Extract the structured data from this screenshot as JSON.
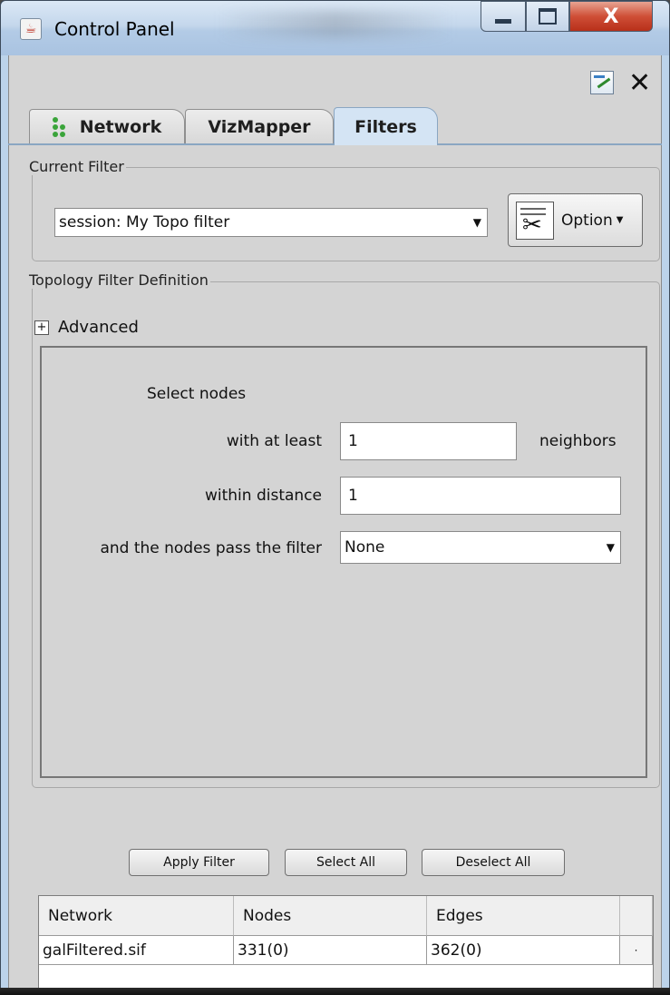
{
  "window": {
    "title": "Control Panel"
  },
  "tabs": [
    {
      "label": "Network"
    },
    {
      "label": "VizMapper"
    },
    {
      "label": "Filters"
    }
  ],
  "current_filter": {
    "legend": "Current Filter",
    "selected": "session: My Topo filter",
    "option_label": "Option"
  },
  "topology": {
    "legend": "Topology Filter Definition",
    "advanced_label": "Advanced",
    "advanced_toggle": "+",
    "select_nodes": "Select nodes",
    "at_least_label": "with at least",
    "at_least_value": "1",
    "neighbors_label": "neighbors",
    "distance_label": "within distance",
    "distance_value": "1",
    "pass_label": "and the nodes pass the filter",
    "pass_value": "None"
  },
  "buttons": {
    "apply": "Apply Filter",
    "select_all": "Select All",
    "deselect_all": "Deselect All"
  },
  "table": {
    "headers": [
      "Network",
      "Nodes",
      "Edges"
    ],
    "rows": [
      [
        "galFiltered.sif",
        "331(0)",
        "362(0)"
      ]
    ]
  }
}
